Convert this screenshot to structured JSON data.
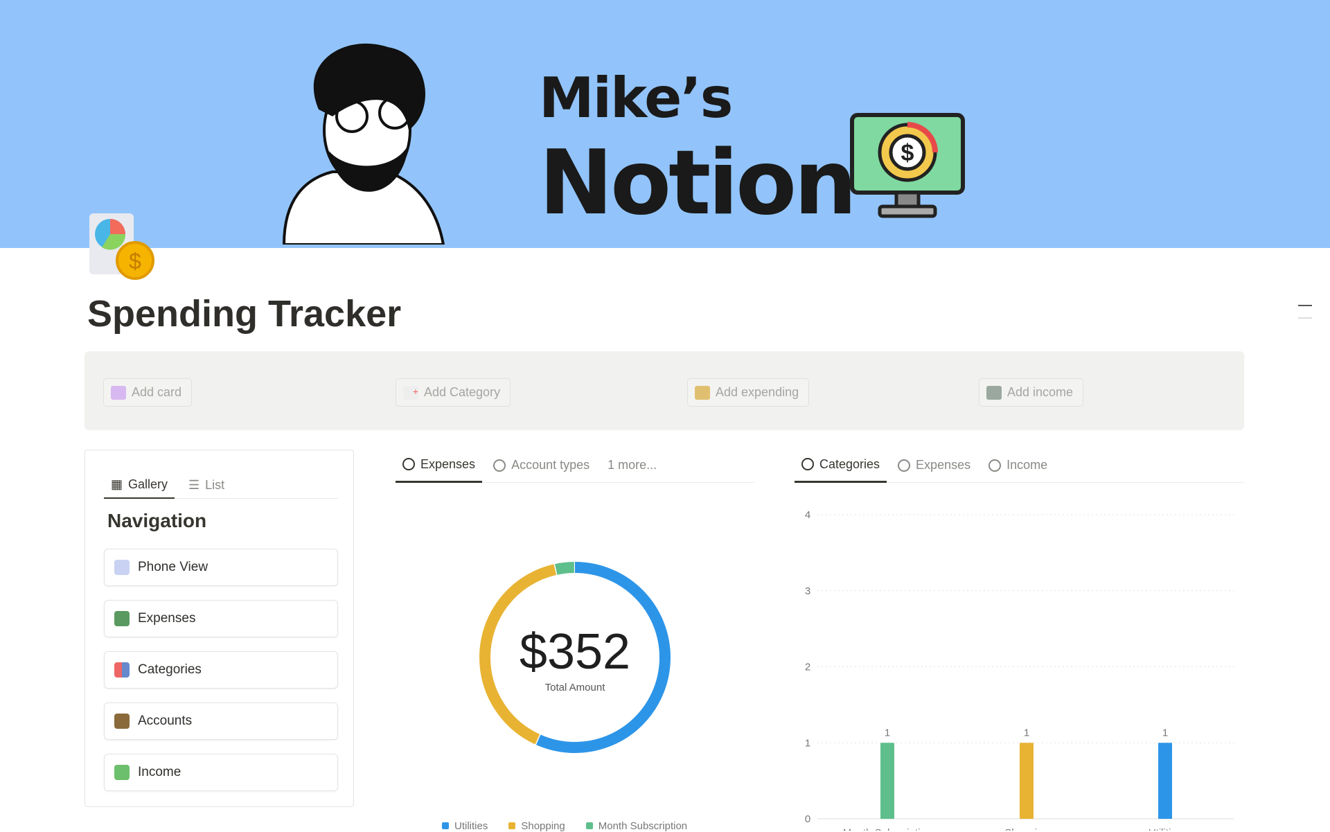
{
  "banner": {
    "line1": "Mike’s",
    "line2": "Notion"
  },
  "page": {
    "title": "Spending Tracker"
  },
  "quick_actions": [
    {
      "label": "Add card",
      "icon": "credit-card-icon"
    },
    {
      "label": "Add Category",
      "icon": "category-icon"
    },
    {
      "label": "Add expending",
      "icon": "receipt-icon"
    },
    {
      "label": "Add income",
      "icon": "cash-icon"
    }
  ],
  "navigation": {
    "tabs": [
      {
        "label": "Gallery"
      },
      {
        "label": "List"
      }
    ],
    "heading": "Navigation",
    "items": [
      {
        "label": "Phone View"
      },
      {
        "label": "Expenses"
      },
      {
        "label": "Categories"
      },
      {
        "label": "Accounts"
      },
      {
        "label": "Income"
      }
    ]
  },
  "middle_tabs": [
    {
      "label": "Expenses"
    },
    {
      "label": "Account types"
    },
    {
      "label": "1 more..."
    }
  ],
  "right_tabs": [
    {
      "label": "Categories"
    },
    {
      "label": "Expenses"
    },
    {
      "label": "Income"
    }
  ],
  "colors": {
    "utilities": "#2d95e8",
    "shopping": "#e8b333",
    "month_subscription": "#5fbf8c"
  },
  "chart_data": [
    {
      "type": "pie",
      "title": "Expenses",
      "center_value": "$352",
      "center_label": "Total Amount",
      "slices": [
        {
          "name": "Utilities",
          "value": 200
        },
        {
          "name": "Shopping",
          "value": 140
        },
        {
          "name": "Month Subscription",
          "value": 12
        }
      ],
      "legend": [
        "Utilities",
        "Shopping",
        "Month Subscription"
      ],
      "legend_position": "bottom"
    },
    {
      "type": "bar",
      "title": "Categories",
      "categories": [
        "Month Subscription",
        "Shopping",
        "Utilities"
      ],
      "values": [
        1,
        1,
        1
      ],
      "data_labels": [
        "1",
        "1",
        "1"
      ],
      "ylim": [
        0,
        4
      ],
      "yticks": [
        "0",
        "1",
        "2",
        "3",
        "4"
      ],
      "grid": true
    }
  ]
}
